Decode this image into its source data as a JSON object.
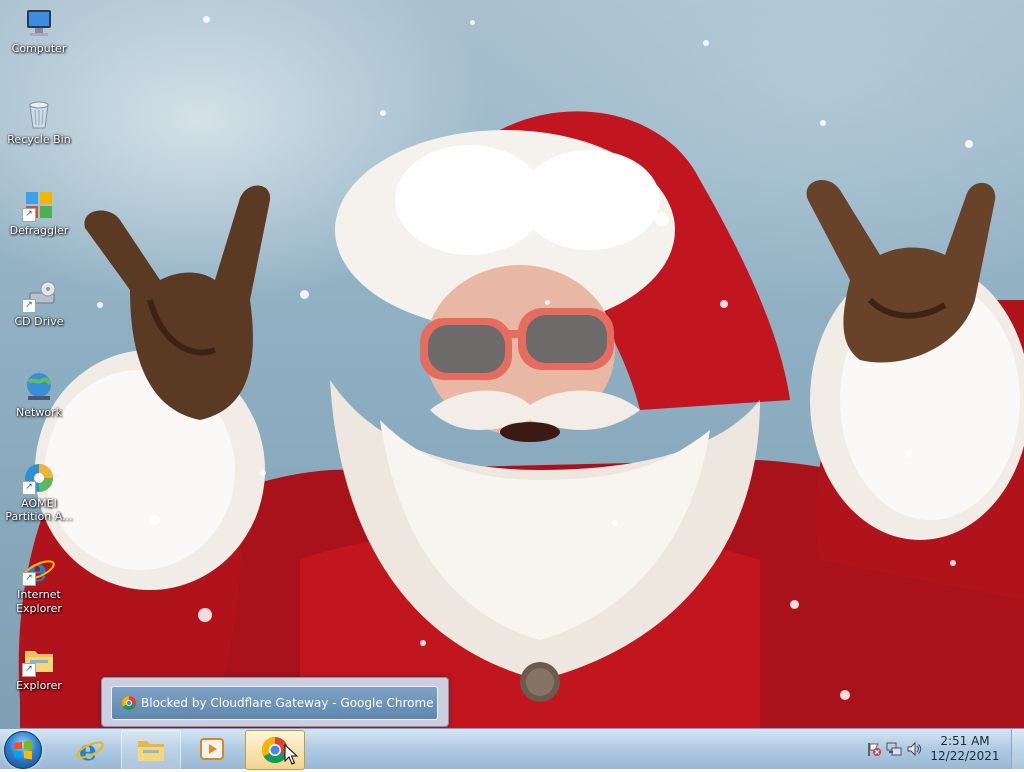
{
  "desktop": {
    "icons": [
      {
        "label": "Computer",
        "icon": "computer-icon"
      },
      {
        "label": "Recycle Bin",
        "icon": "recycle-bin-icon"
      },
      {
        "label": "Defraggler",
        "icon": "defraggler-icon"
      },
      {
        "label": "CD Drive",
        "icon": "cd-drive-icon"
      },
      {
        "label": "Network",
        "icon": "network-icon"
      },
      {
        "label": "AOMEI Partition A...",
        "icon": "aomei-icon"
      },
      {
        "label": "Internet Explorer",
        "icon": "internet-explorer-icon"
      },
      {
        "label": "Explorer",
        "icon": "explorer-icon"
      }
    ]
  },
  "preview": {
    "title": "Blocked by Cloudflare Gateway - Google Chrome",
    "icon": "chrome-icon"
  },
  "taskbar": {
    "start_icon": "windows-logo-icon",
    "pinned": [
      {
        "name": "internet-explorer",
        "icon": "internet-explorer-icon"
      },
      {
        "name": "windows-explorer",
        "icon": "folder-icon"
      },
      {
        "name": "media-player",
        "icon": "media-player-icon"
      },
      {
        "name": "google-chrome",
        "icon": "chrome-icon",
        "active": true
      }
    ],
    "tray": {
      "icons": [
        "action-center-flag-icon",
        "network-status-icon",
        "volume-icon"
      ],
      "time": "2:51 AM",
      "date": "12/22/2021"
    }
  },
  "colors": {
    "taskbar": "#a9c6e2",
    "active_button": "#f0d590",
    "wallpaper_sky": "#8fb0c2",
    "santa_red": "#b3121c"
  }
}
